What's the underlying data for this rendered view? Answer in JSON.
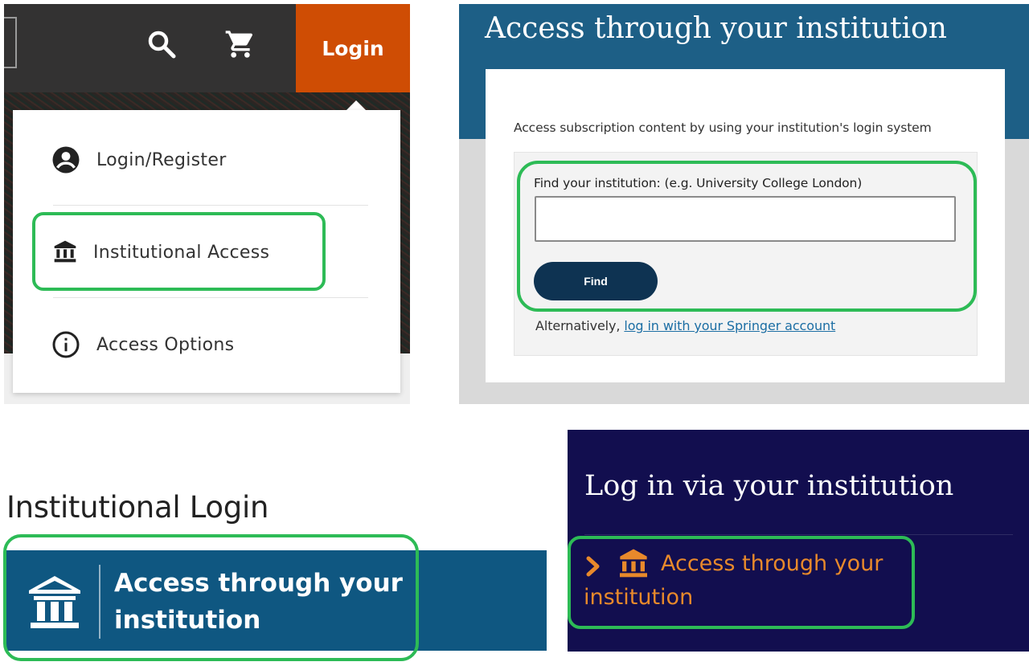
{
  "panel_login_menu": {
    "topbar": {
      "search_icon": "search-icon",
      "cart_icon": "cart-icon",
      "login_label": "Login"
    },
    "menu": {
      "items": [
        {
          "label": "Login/Register",
          "icon": "account-circle-icon"
        },
        {
          "label": "Institutional Access",
          "icon": "bank-icon"
        },
        {
          "label": "Access Options",
          "icon": "info-icon"
        }
      ]
    }
  },
  "panel_institution_form": {
    "heading": "Access through your institution",
    "description": "Access subscription content by using your institution's login system",
    "field_label": "Find your institution: (e.g. University College London)",
    "field_value": "",
    "find_button": "Find",
    "alternative_prefix": "Alternatively, ",
    "alternative_link": "log in with your Springer account"
  },
  "panel_institutional_login": {
    "title": "Institutional Login",
    "button_label": "Access through your institution",
    "icon": "institution-icon"
  },
  "panel_login_via": {
    "heading": "Log in via your institution",
    "link_label": "Access through your institution",
    "icons": [
      "chevron-right-icon",
      "bank-icon"
    ]
  },
  "colors": {
    "login_orange": "#cf4d04",
    "topbar_dark": "#333232",
    "springer_blue": "#1d5f86",
    "find_button_navy": "#0e3352",
    "institutional_bar_blue": "#0f5781",
    "login_via_navy": "#120e4f",
    "link_orange": "#e8892b",
    "highlight_green": "#2dbb56"
  }
}
